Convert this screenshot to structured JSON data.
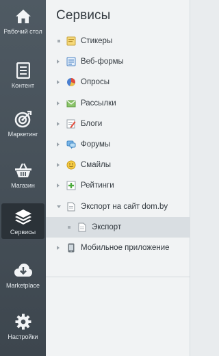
{
  "rail": {
    "items": [
      {
        "label": "Рабочий стол",
        "icon": "home-icon"
      },
      {
        "label": "Контент",
        "icon": "document-icon"
      },
      {
        "label": "Маркетинг",
        "icon": "target-icon"
      },
      {
        "label": "Магазин",
        "icon": "basket-icon"
      },
      {
        "label": "Сервисы",
        "icon": "layers-icon",
        "active": true
      },
      {
        "label": "Marketplace",
        "icon": "cloud-download-icon"
      },
      {
        "label": "Настройки",
        "icon": "gear-icon"
      }
    ]
  },
  "panel": {
    "title": "Сервисы",
    "items": [
      {
        "label": "Стикеры",
        "icon": "stickers-icon"
      },
      {
        "label": "Веб-формы",
        "icon": "webforms-icon"
      },
      {
        "label": "Опросы",
        "icon": "polls-icon"
      },
      {
        "label": "Рассылки",
        "icon": "mailing-icon"
      },
      {
        "label": "Блоги",
        "icon": "blogs-icon"
      },
      {
        "label": "Форумы",
        "icon": "forums-icon"
      },
      {
        "label": "Смайлы",
        "icon": "smiles-icon"
      },
      {
        "label": "Рейтинги",
        "icon": "ratings-icon"
      },
      {
        "label": "Экспорт на сайт dom.by",
        "icon": "export-icon",
        "expanded": true
      },
      {
        "label": "Экспорт",
        "icon": "page-icon",
        "sub": true,
        "selected": true
      },
      {
        "label": "Мобильное приложение",
        "icon": "mobile-app-icon"
      }
    ]
  }
}
